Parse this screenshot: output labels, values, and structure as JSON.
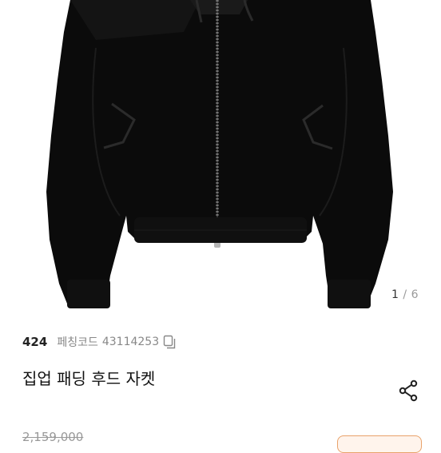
{
  "gallery": {
    "image_subject": "black zip-up hooded jacket",
    "current_page": "1",
    "separator": "/",
    "total_pages": "6"
  },
  "product": {
    "brand": "424",
    "code_label": "페칭코드",
    "code_value": "43114253",
    "title": "집업 패딩 후드 자켓",
    "price": "2,159,000"
  },
  "icons": {
    "copy": "copy-icon",
    "share": "share-icon"
  },
  "colors": {
    "jacket": "#0b0b0b",
    "accent_orange": "#e9a26a"
  }
}
